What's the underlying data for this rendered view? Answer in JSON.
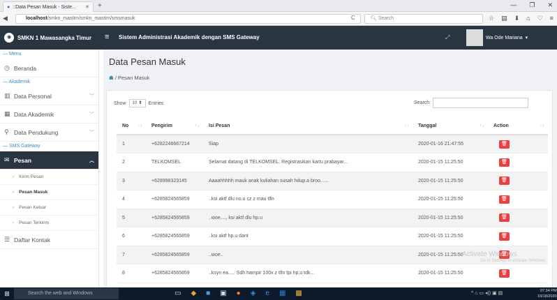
{
  "browser": {
    "tab_title": "::Data Pesan Masuk - Siste...",
    "tab_close": "✕",
    "new_tab": "+",
    "url_host": "localhost",
    "url_path": "/smkn_mastim/smkn_mastim/smsmasuk",
    "search_placeholder": "Search",
    "reload": "C"
  },
  "header": {
    "brand": "SMKN 1 Mawasangka Timur",
    "app_title": "Sistem Administrasi Akademik dengan SMS Gateway",
    "user_name": "Wa Ode Mariana"
  },
  "sidebar": {
    "section_menu": "— Menu",
    "beranda": "Beranda",
    "section_akademik": "— Akademik",
    "data_personal": "Data Personal",
    "data_akademik": "Data Akademik",
    "data_pendukung": "Data Pendukung",
    "section_sms": "— SMS Gateway",
    "pesan": "Pesan",
    "kirim_pesan": "Kirim Pesan",
    "pesan_masuk": "Pesan Masuk",
    "pesan_keluar": "Pesan Keluar",
    "pesan_terkirim": "Pesan Terkirim",
    "daftar_kontak": "Daftar Kontak"
  },
  "page": {
    "title": "Data Pesan Masuk",
    "breadcrumb": "/ Pesan Masuk",
    "show_label": "Show",
    "show_value": "10",
    "entries_label": "Entries",
    "search_label": "Search:"
  },
  "table": {
    "headers": [
      "No",
      "Pengirim",
      "Isi Pesan",
      "Tanggal",
      "Action"
    ],
    "rows": [
      {
        "no": "1",
        "pengirim": "+6282246667214",
        "isi": "Siap",
        "tanggal": "2020-01-16 21:47:55"
      },
      {
        "no": "2",
        "pengirim": "TELKOMSEL",
        "isi": "Selamat datang di TELKOMSEL. Registrasikan kartu prabayar...",
        "tanggal": "2020-01-15 11:25:50"
      },
      {
        "no": "3",
        "pengirim": "+628998323145",
        "isi": "Aaaahhhhh mauk anak kuliahan susah hdup.a broo......",
        "tanggal": "2020-01-15 11:25:50"
      },
      {
        "no": "4",
        "pengirim": "+6285824565859",
        "isi": "..ksi aktf dlu no.u cz z mau tlfn",
        "tanggal": "2020-01-15 11:25:50"
      },
      {
        "no": "5",
        "pengirim": "+6285824565859",
        "isi": "..woe...., ksi aktf dlu hp.u",
        "tanggal": "2020-01-15 11:25:50"
      },
      {
        "no": "6",
        "pengirim": "+6285824565859",
        "isi": "..ksi aktf hp.u dant",
        "tanggal": "2020-01-15 11:25:50"
      },
      {
        "no": "7",
        "pengirim": "+6285824565859",
        "isi": "..woe..",
        "tanggal": "2020-01-15 11:25:50"
      },
      {
        "no": "8",
        "pengirim": "+6285824565859",
        "isi": "..ksyn ea..... Sdh hampir 100x z tlfn tpi hp.u tdk...",
        "tanggal": "2020-01-15 11:25:50"
      }
    ]
  },
  "watermark": {
    "line1": "Activate Windows",
    "line2": "Go to Settings to activate Windows."
  },
  "taskbar": {
    "search": "Search the web and Windows",
    "time": "07:34 PM",
    "date": "10/18/2020"
  },
  "colors": {
    "topbar": "#2a3542",
    "accent": "#3c8dbc",
    "delete": "#e8413f"
  }
}
